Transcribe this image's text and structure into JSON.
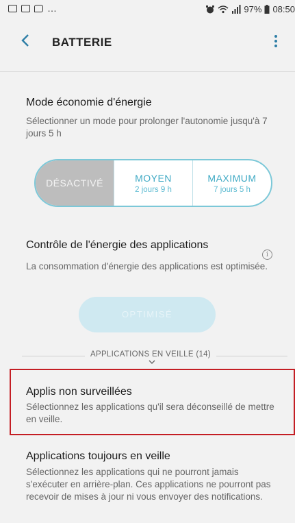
{
  "status_bar": {
    "battery_percent": "97%",
    "time": "08:50",
    "notification_icons": [
      "gallery-icon",
      "mail-icon",
      "message-icon"
    ],
    "overflow": "…"
  },
  "app_bar": {
    "back_glyph": "<",
    "title": "BATTERIE",
    "more_icon": "more-vert-icon"
  },
  "power_saving": {
    "title": "Mode économie d'énergie",
    "description": "Sélectionner un mode pour prolonger l'autonomie jusqu'à 7 jours 5 h",
    "modes": [
      {
        "label": "DÉSACTIVÉ",
        "sub": "",
        "selected": true
      },
      {
        "label": "MOYEN",
        "sub": "2 jours 9 h",
        "selected": false
      },
      {
        "label": "MAXIMUM",
        "sub": "7 jours 5 h",
        "selected": false
      }
    ]
  },
  "app_power": {
    "title": "Contrôle de l'énergie des applications",
    "description": "La consommation d'énergie des applications est optimisée.",
    "button_label": "OPTIMISÉ",
    "info_icon": "info-icon"
  },
  "standby_section": {
    "label": "APPLICATIONS EN VEILLE (14)",
    "chevron": "⌄"
  },
  "unmonitored": {
    "title": "Applis non surveillées",
    "description": "Sélectionnez les applications qu'il sera déconseillé de mettre en veille."
  },
  "always_sleep": {
    "title": "Applications toujours en veille",
    "description": "Sélectionnez les applications qui ne pourront jamais s'exécuter en arrière-plan. Ces applications ne pourront pas recevoir de mises à jour ni vous envoyer des notifications."
  },
  "colors": {
    "accent": "#2d7ea6",
    "highlight": "#c41e24",
    "selected_mode": "#bdbdbd"
  }
}
